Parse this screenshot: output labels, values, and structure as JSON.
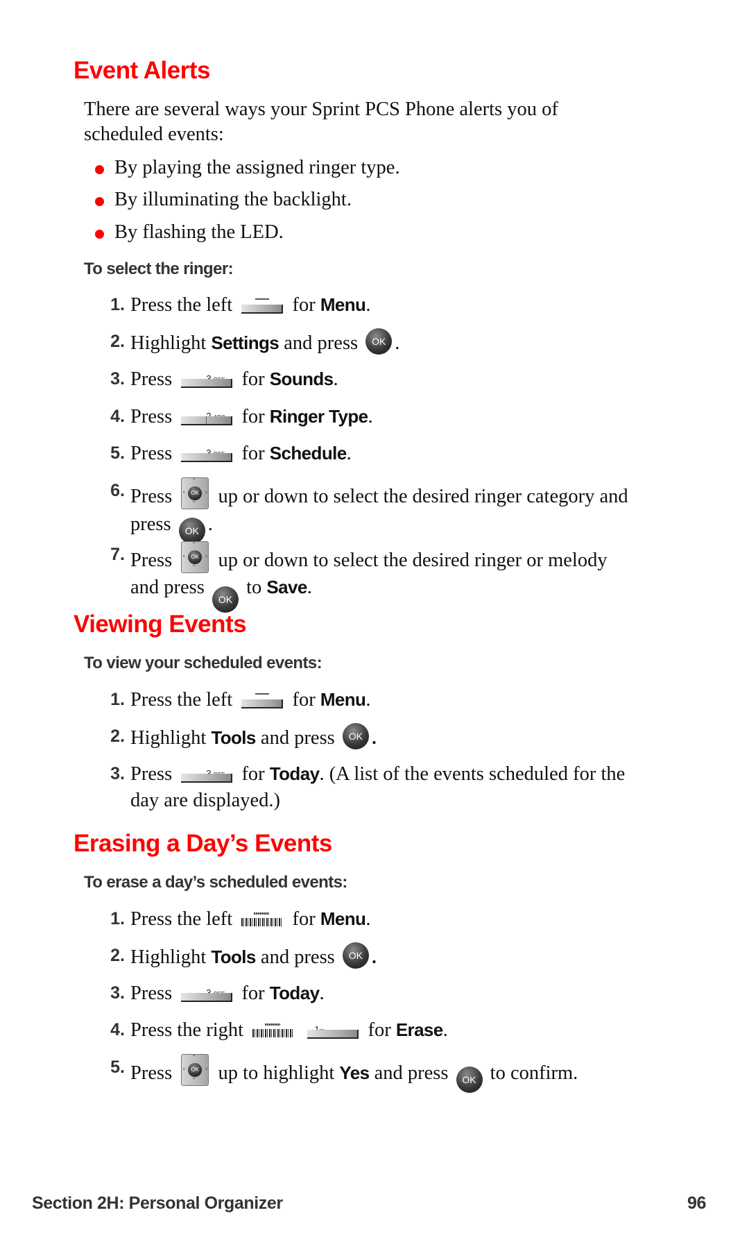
{
  "sections": {
    "event_alerts": {
      "title": "Event Alerts",
      "intro": "There are several ways your Sprint PCS Phone alerts you of scheduled events:",
      "intro_line1": "There are several ways your Sprint PCS Phone alerts you of",
      "intro_line2": "scheduled events:",
      "bullets": [
        "By playing the assigned ringer type.",
        "By illuminating the backlight.",
        "By flashing the LED."
      ],
      "procedure_title": "To select the ringer:",
      "steps": [
        {
          "num": "1.",
          "pre": "Press the left",
          "icon": "left-softkey-icon",
          "mid": "for",
          "key": "Menu",
          "post": "."
        },
        {
          "num": "2.",
          "pre": "Highlight",
          "key": "Settings",
          "mid": "and press",
          "icon": "ok-button-icon",
          "post": "."
        },
        {
          "num": "3.",
          "pre": "Press",
          "icon": "3-def-key-icon",
          "icon_label": "3",
          "icon_sub": "DEF",
          "mid": "for",
          "key": "Sounds",
          "post": "."
        },
        {
          "num": "4.",
          "pre": "Press",
          "icon": "2-abc-key-icon",
          "icon_label": "2",
          "icon_sub": "ABC",
          "mid": "for",
          "key": "Ringer Type",
          "post": "."
        },
        {
          "num": "5.",
          "pre": "Press",
          "icon": "3-def-key-icon",
          "icon_label": "3",
          "icon_sub": "DEF",
          "mid": "for",
          "key": "Schedule",
          "post": "."
        },
        {
          "num": "6.",
          "pre": "Press",
          "icon": "navigation-key-icon",
          "line1_rest": "up or down to select the desired ringer category and",
          "line2_pre": "press",
          "icon2": "ok-button-icon",
          "post": "."
        },
        {
          "num": "7.",
          "pre": "Press",
          "icon": "navigation-key-icon",
          "line1_rest": "up or down to select the desired ringer or melody",
          "line2_pre": "and press",
          "icon2": "ok-button-icon",
          "mid": "to",
          "key": "Save",
          "post": "."
        }
      ]
    },
    "viewing_events": {
      "title": "Viewing Events",
      "procedure_title": "To view your scheduled events:",
      "steps": [
        {
          "num": "1.",
          "pre": "Press the left",
          "icon": "left-softkey-icon",
          "mid": "for",
          "key": "Menu",
          "post": "."
        },
        {
          "num": "2.",
          "pre": "Highlight",
          "key": "Tools",
          "mid": "and press",
          "icon": "ok-button-icon",
          "post": "."
        },
        {
          "num": "3.",
          "pre": "Press",
          "icon": "3-def-key-icon",
          "icon_label": "3",
          "icon_sub": "DEF",
          "mid": "for",
          "key": "Today",
          "post": ". (A list of the events scheduled for the",
          "line2": "day are displayed.)"
        }
      ]
    },
    "erasing_events": {
      "title": "Erasing a Day’s Events",
      "procedure_title": "To erase a day’s scheduled events:",
      "steps": [
        {
          "num": "1.",
          "pre": "Press the left",
          "icon": "left-softkey-icon",
          "mid": "for",
          "key": "Menu",
          "post": "."
        },
        {
          "num": "2.",
          "pre": "Highlight",
          "key": "Tools",
          "mid": "and press",
          "icon": "ok-button-icon",
          "post": "."
        },
        {
          "num": "3.",
          "pre": "Press",
          "icon": "3-def-key-icon",
          "icon_label": "3",
          "icon_sub": "DEF",
          "mid": "for",
          "key": "Today",
          "post": "."
        },
        {
          "num": "4.",
          "pre": "Press the right",
          "icon": "right-softkey-icon",
          "icon2": "1-voicemail-key-icon",
          "icon2_label": "1",
          "icon2_sub": "✉",
          "mid": "for",
          "key": "Erase",
          "post": "."
        },
        {
          "num": "5.",
          "pre": "Press",
          "icon": "navigation-key-icon",
          "mid": "up to highlight",
          "key": "Yes",
          "mid2": "and press",
          "icon2": "ok-button-icon",
          "post": "to confirm."
        }
      ]
    }
  },
  "icons": {
    "ok_label": "OK",
    "nav_up": "˄",
    "nav_down": "˅",
    "nav_left": "‹",
    "nav_right": "›"
  },
  "footer": {
    "section": "Section 2H: Personal Organizer",
    "page_number": "96"
  },
  "colors": {
    "heading": "#ff0000",
    "bullet": "#ff0000",
    "subheading": "#333333",
    "body": "#111111"
  }
}
